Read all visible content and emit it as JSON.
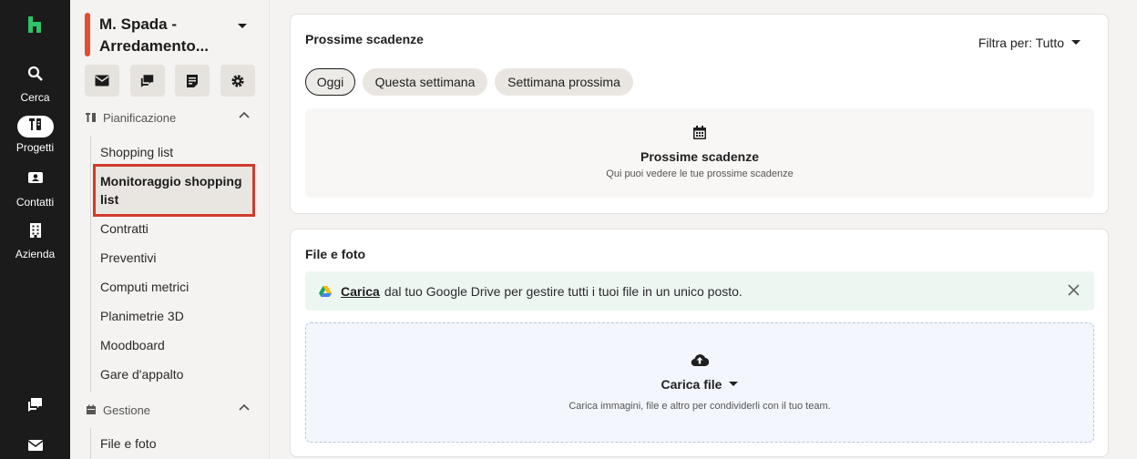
{
  "rail": {
    "items": [
      {
        "label": "Cerca",
        "icon": "search-icon"
      },
      {
        "label": "Progetti",
        "icon": "projects-icon"
      },
      {
        "label": "Contatti",
        "icon": "contacts-icon"
      },
      {
        "label": "Azienda",
        "icon": "company-icon"
      }
    ],
    "bottom": [
      {
        "icon": "chat-icon"
      },
      {
        "icon": "mail-icon"
      }
    ]
  },
  "project": {
    "name": "M. Spada - Arredamento..."
  },
  "quick_actions": [
    "mail-icon",
    "chat-icon",
    "notes-icon",
    "settings-icon"
  ],
  "sections": {
    "planning": {
      "title": "Pianificazione",
      "items": [
        "Shopping list",
        "Monitoraggio shopping list",
        "Contratti",
        "Preventivi",
        "Computi metrici",
        "Planimetrie 3D",
        "Moodboard",
        "Gare d'appalto"
      ],
      "active_index": 1
    },
    "management": {
      "title": "Gestione",
      "items": [
        "File e foto"
      ]
    }
  },
  "deadlines": {
    "title": "Prossime scadenze",
    "filter_label": "Filtra per: Tutto",
    "pills": [
      "Oggi",
      "Questa settimana",
      "Settimana prossima"
    ],
    "selected_pill": 0,
    "empty_title": "Prossime scadenze",
    "empty_subtitle": "Qui puoi vedere le tue prossime scadenze"
  },
  "files": {
    "title": "File e foto",
    "banner_link": "Carica",
    "banner_text": "dal tuo Google Drive per gestire tutti i tuoi file in un unico posto.",
    "upload_title": "Carica file",
    "upload_subtitle": "Carica immagini, file e altro per condividerli con il tuo team."
  },
  "colors": {
    "accent": "#e44d2e",
    "active_border": "#d23a2a",
    "logo": "#2dc26b",
    "rail": "#1b1b1b"
  }
}
